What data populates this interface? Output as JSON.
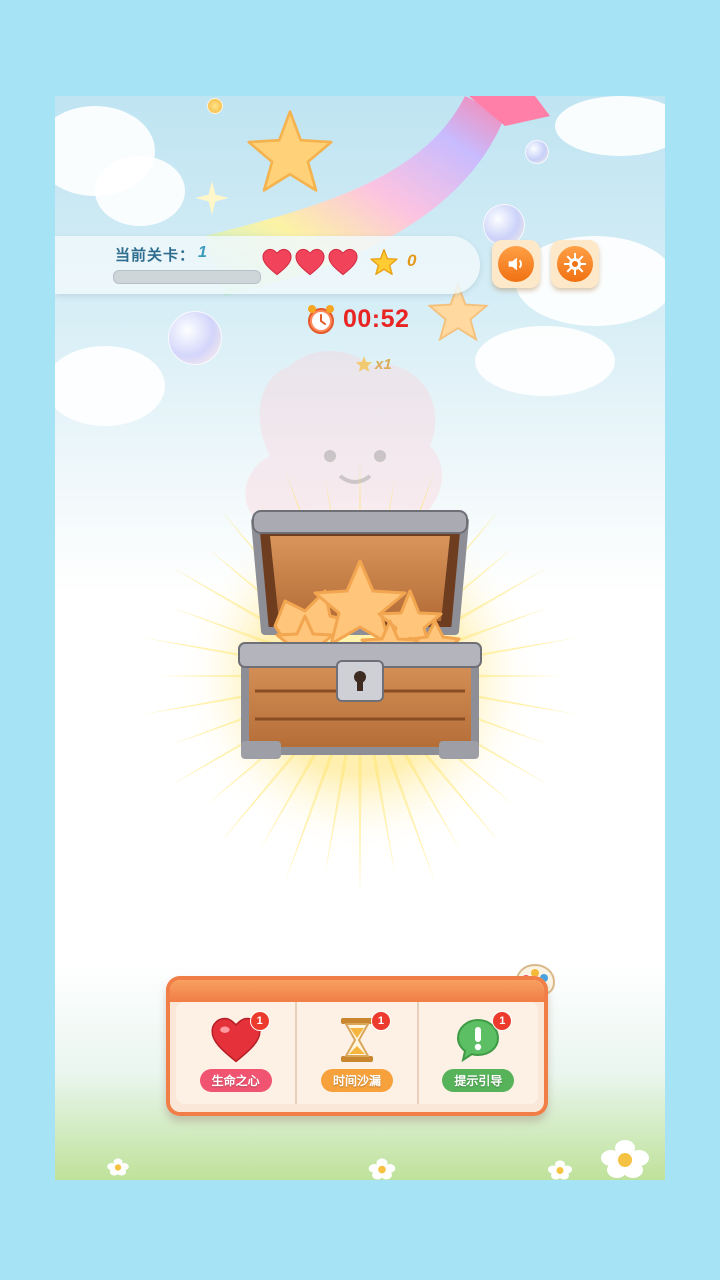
{
  "hud": {
    "level_label": "当前关卡：",
    "level_value": "1",
    "level_progress": 0.0,
    "lives": 3,
    "star_count": "0"
  },
  "timer": {
    "value": "00:52"
  },
  "multiplier": {
    "text": "x1"
  },
  "buttons": {
    "sound": {
      "icon": "speaker-icon"
    },
    "settings": {
      "icon": "gear-icon"
    }
  },
  "center": {
    "icon": "treasure-chest"
  },
  "powerups": [
    {
      "label": "生命之心",
      "count": "1",
      "icon": "heart-icon",
      "color": "#f05470"
    },
    {
      "label": "时间沙漏",
      "count": "1",
      "icon": "hourglass-icon",
      "color": "#f6a13b"
    },
    {
      "label": "提示引导",
      "count": "1",
      "icon": "exclamation-bubble-icon",
      "color": "#56b35a"
    }
  ]
}
